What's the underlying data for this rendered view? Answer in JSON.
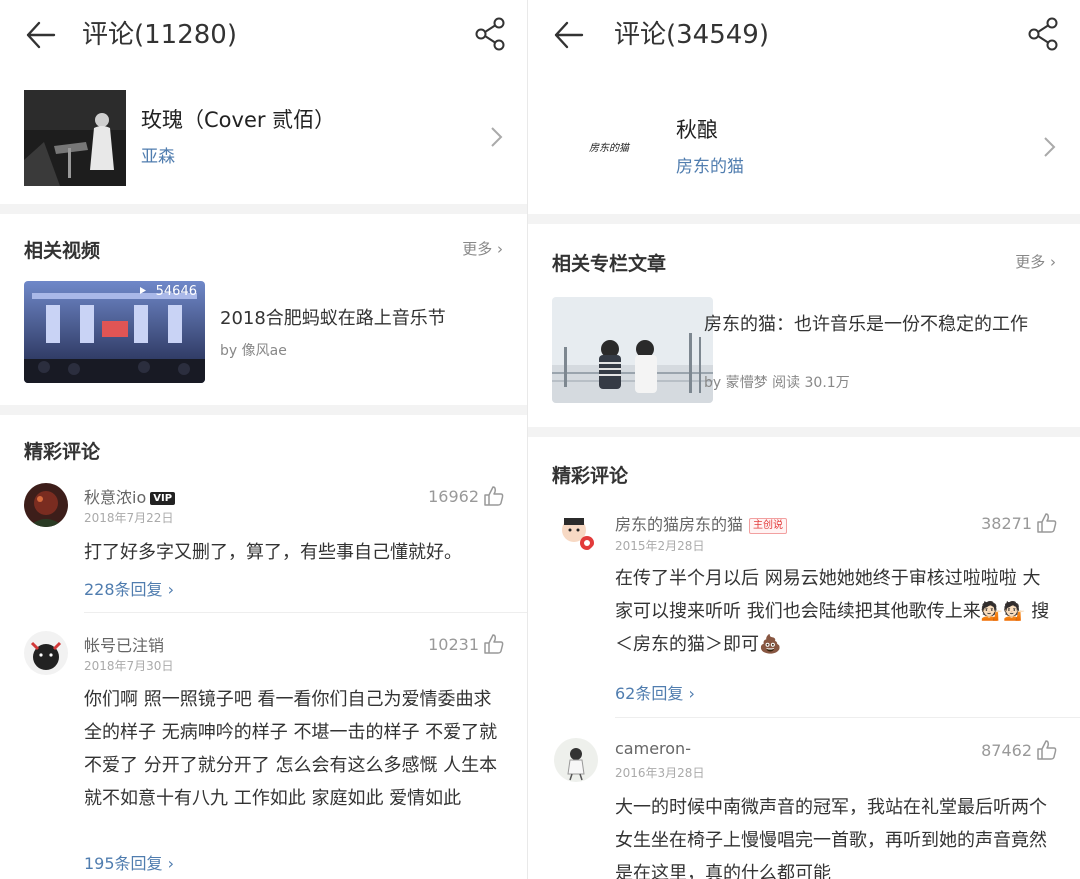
{
  "left": {
    "header": {
      "title": "评论(11280)"
    },
    "song": {
      "name": "玫瑰（Cover 贰佰）",
      "artist": "亚森"
    },
    "related": {
      "title": "相关视频",
      "more": "更多",
      "item": {
        "title": "2018合肥蚂蚁在路上音乐节",
        "author": "by 像风ae",
        "play_count": "54646"
      }
    },
    "featured_title": "精彩评论",
    "comments": [
      {
        "nickname": "秋意浓io",
        "badge": "VIP",
        "date": "2018年7月22日",
        "likes": "16962",
        "content": "打了好多字又删了，算了，有些事自己懂就好。",
        "replies": "228条回复"
      },
      {
        "nickname": "帐号已注销",
        "date": "2018年7月30日",
        "likes": "10231",
        "content": "你们啊 照一照镜子吧 看一看你们自己为爱情委曲求全的样子 无病呻吟的样子 不堪一击的样子 不爱了就不爱了 分开了就分开了 怎么会有这么多感慨 人生本就不如意十有八九 工作如此 家庭如此 爱情如此",
        "replies": "195条回复"
      }
    ]
  },
  "right": {
    "header": {
      "title": "评论(34549)"
    },
    "song": {
      "name": "秋酿",
      "artist": "房东的猫",
      "cover_text": "房东的猫"
    },
    "related": {
      "title": "相关专栏文章",
      "more": "更多",
      "item": {
        "title": "房东的猫：也许音乐是一份不稳定的工作",
        "author": "by 蒙懵梦 阅读 30.1万"
      }
    },
    "featured_title": "精彩评论",
    "comments": [
      {
        "nickname": "房东的猫房东的猫",
        "badge": "主创说",
        "date": "2015年2月28日",
        "likes": "38271",
        "content": "在传了半个月以后 网易云她她她终于审核过啦啦啦 大家可以搜来听听 我们也会陆续把其他歌传上来💁🏻💁🏻 搜＜房东的猫＞即可💩",
        "replies": "62条回复"
      },
      {
        "nickname": "cameron-",
        "date": "2016年3月28日",
        "likes": "87462",
        "content": "大一的时候中南微声音的冠军，我站在礼堂最后听两个女生坐在椅子上慢慢唱完一首歌，再听到她的声音竟然是在这里，真的什么都可能"
      }
    ]
  }
}
